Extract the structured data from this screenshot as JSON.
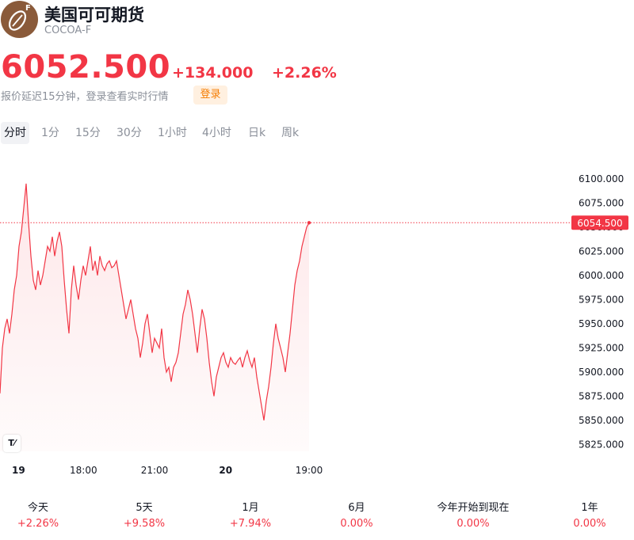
{
  "header": {
    "logo_badge": "F",
    "name": "美国可可期货",
    "ticker": "COCOA-F"
  },
  "quote": {
    "price": "6052.500",
    "change": "+134.000",
    "change_pct": "+2.26%",
    "delay_note": "报价延迟15分钟，登录查看实时行情",
    "login_label": "登录"
  },
  "interval_tabs": [
    {
      "label": "分时",
      "active": true
    },
    {
      "label": "1分",
      "active": false
    },
    {
      "label": "15分",
      "active": false
    },
    {
      "label": "30分",
      "active": false
    },
    {
      "label": "1小时",
      "active": false
    },
    {
      "label": "4小时",
      "active": false
    },
    {
      "label": "日k",
      "active": false
    },
    {
      "label": "周k",
      "active": false
    }
  ],
  "colors": {
    "up": "#f23645",
    "accent": "#f57c00",
    "logo_bg": "#8a5a3a"
  },
  "chart_data": {
    "type": "line",
    "y_tick_labels": [
      "6100.000",
      "6075.000",
      "6050.000",
      "6025.000",
      "6000.000",
      "5975.000",
      "5950.000",
      "5925.000",
      "5900.000",
      "5875.000",
      "5850.000",
      "5825.000"
    ],
    "y_ticks": [
      6100,
      6075,
      6050,
      6025,
      6000,
      5975,
      5950,
      5925,
      5900,
      5875,
      5850,
      5825
    ],
    "ylim": [
      5818,
      6108
    ],
    "x_tick_labels": [
      {
        "label": "19",
        "t": 0.06,
        "bold": true
      },
      {
        "label": "18:00",
        "t": 0.27,
        "bold": false
      },
      {
        "label": "21:00",
        "t": 0.5,
        "bold": false
      },
      {
        "label": "20",
        "t": 0.73,
        "bold": true
      },
      {
        "label": "19:00",
        "t": 1.0,
        "bold": false
      }
    ],
    "last_price_label": "6054.500",
    "last_price": 6054.5,
    "series": [
      {
        "values": [
          5878,
          5925,
          5945,
          5955,
          5940,
          5960,
          5985,
          6000,
          6030,
          6045,
          6070,
          6095,
          6055,
          6020,
          5995,
          5985,
          6005,
          5990,
          6000,
          6015,
          6030,
          6025,
          6040,
          6020,
          6035,
          6045,
          6030,
          5995,
          5965,
          5940,
          5985,
          6010,
          5990,
          5975,
          5995,
          6010,
          6000,
          6015,
          6030,
          6005,
          6015,
          6000,
          6020,
          6010,
          6005,
          6012,
          6015,
          6008,
          6010,
          6015,
          6000,
          5985,
          5970,
          5955,
          5965,
          5975,
          5960,
          5945,
          5935,
          5915,
          5930,
          5950,
          5960,
          5940,
          5920,
          5935,
          5930,
          5925,
          5945,
          5915,
          5900,
          5905,
          5890,
          5905,
          5910,
          5920,
          5940,
          5960,
          5970,
          5985,
          5975,
          5960,
          5940,
          5920,
          5945,
          5965,
          5955,
          5935,
          5910,
          5890,
          5875,
          5895,
          5905,
          5915,
          5920,
          5910,
          5905,
          5915,
          5910,
          5908,
          5912,
          5915,
          5905,
          5915,
          5922,
          5912,
          5905,
          5915,
          5895,
          5880,
          5865,
          5850,
          5870,
          5885,
          5905,
          5930,
          5950,
          5935,
          5925,
          5915,
          5900,
          5920,
          5940,
          5965,
          5990,
          6005,
          6015,
          6030,
          6040,
          6050,
          6054.5
        ]
      }
    ]
  },
  "performance": [
    {
      "label": "今天",
      "value": "+2.26%"
    },
    {
      "label": "5天",
      "value": "+9.58%"
    },
    {
      "label": "1月",
      "value": "+7.94%"
    },
    {
      "label": "6月",
      "value": "0.00%"
    },
    {
      "label": "今年开始到现在",
      "value": "0.00%"
    },
    {
      "label": "1年",
      "value": "0.00%"
    }
  ]
}
